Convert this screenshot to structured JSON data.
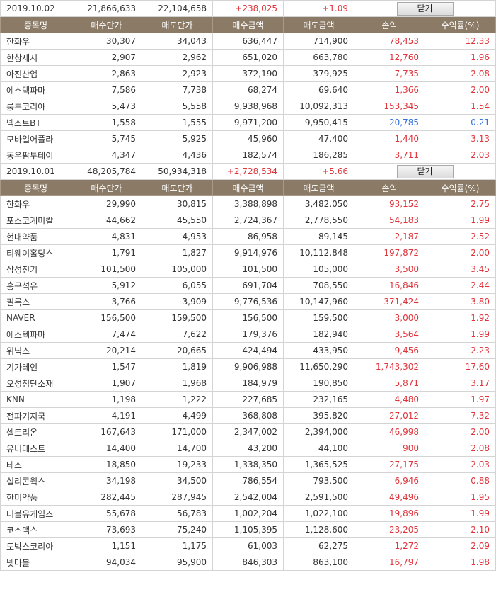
{
  "close_label": "닫기",
  "headers": [
    "종목명",
    "매수단가",
    "매도단가",
    "매수금액",
    "매도금액",
    "손익",
    "수익률(%)"
  ],
  "days": [
    {
      "date": "2019.10.02",
      "buy_total": "21,866,633",
      "sell_total": "22,104,658",
      "profit": "+238,025",
      "rate": "+1.09",
      "rows": [
        [
          "한화우",
          "30,307",
          "34,043",
          "636,447",
          "714,900",
          "78,453",
          "12.33"
        ],
        [
          "한창제지",
          "2,907",
          "2,962",
          "651,020",
          "663,780",
          "12,760",
          "1.96"
        ],
        [
          "아진산업",
          "2,863",
          "2,923",
          "372,190",
          "379,925",
          "7,735",
          "2.08"
        ],
        [
          "에스텍파마",
          "7,586",
          "7,738",
          "68,274",
          "69,640",
          "1,366",
          "2.00"
        ],
        [
          "룽투코리아",
          "5,473",
          "5,558",
          "9,938,968",
          "10,092,313",
          "153,345",
          "1.54"
        ],
        [
          "넥스트BT",
          "1,558",
          "1,555",
          "9,971,200",
          "9,950,415",
          "-20,785",
          "-0.21"
        ],
        [
          "모바일어플라",
          "5,745",
          "5,925",
          "45,960",
          "47,400",
          "1,440",
          "3.13"
        ],
        [
          "동우팜투테이",
          "4,347",
          "4,436",
          "182,574",
          "186,285",
          "3,711",
          "2.03"
        ]
      ]
    },
    {
      "date": "2019.10.01",
      "buy_total": "48,205,784",
      "sell_total": "50,934,318",
      "profit": "+2,728,534",
      "rate": "+5.66",
      "rows": [
        [
          "한화우",
          "29,990",
          "30,815",
          "3,388,898",
          "3,482,050",
          "93,152",
          "2.75"
        ],
        [
          "포스코케미칼",
          "44,662",
          "45,550",
          "2,724,367",
          "2,778,550",
          "54,183",
          "1.99"
        ],
        [
          "현대약품",
          "4,831",
          "4,953",
          "86,958",
          "89,145",
          "2,187",
          "2.52"
        ],
        [
          "티웨이홀딩스",
          "1,791",
          "1,827",
          "9,914,976",
          "10,112,848",
          "197,872",
          "2.00"
        ],
        [
          "삼성전기",
          "101,500",
          "105,000",
          "101,500",
          "105,000",
          "3,500",
          "3.45"
        ],
        [
          "흥구석유",
          "5,912",
          "6,055",
          "691,704",
          "708,550",
          "16,846",
          "2.44"
        ],
        [
          "필룩스",
          "3,766",
          "3,909",
          "9,776,536",
          "10,147,960",
          "371,424",
          "3.80"
        ],
        [
          "NAVER",
          "156,500",
          "159,500",
          "156,500",
          "159,500",
          "3,000",
          "1.92"
        ],
        [
          "에스텍파마",
          "7,474",
          "7,622",
          "179,376",
          "182,940",
          "3,564",
          "1.99"
        ],
        [
          "위닉스",
          "20,214",
          "20,665",
          "424,494",
          "433,950",
          "9,456",
          "2.23"
        ],
        [
          "기가레인",
          "1,547",
          "1,819",
          "9,906,988",
          "11,650,290",
          "1,743,302",
          "17.60"
        ],
        [
          "오성첨단소재",
          "1,907",
          "1,968",
          "184,979",
          "190,850",
          "5,871",
          "3.17"
        ],
        [
          "KNN",
          "1,198",
          "1,222",
          "227,685",
          "232,165",
          "4,480",
          "1.97"
        ],
        [
          "전파기지국",
          "4,191",
          "4,499",
          "368,808",
          "395,820",
          "27,012",
          "7.32"
        ],
        [
          "셀트리온",
          "167,643",
          "171,000",
          "2,347,002",
          "2,394,000",
          "46,998",
          "2.00"
        ],
        [
          "유니테스트",
          "14,400",
          "14,700",
          "43,200",
          "44,100",
          "900",
          "2.08"
        ],
        [
          "테스",
          "18,850",
          "19,233",
          "1,338,350",
          "1,365,525",
          "27,175",
          "2.03"
        ],
        [
          "실리콘웍스",
          "34,198",
          "34,500",
          "786,554",
          "793,500",
          "6,946",
          "0.88"
        ],
        [
          "한미약품",
          "282,445",
          "287,945",
          "2,542,004",
          "2,591,500",
          "49,496",
          "1.95"
        ],
        [
          "더블유게임즈",
          "55,678",
          "56,783",
          "1,002,204",
          "1,022,100",
          "19,896",
          "1.99"
        ],
        [
          "코스맥스",
          "73,693",
          "75,240",
          "1,105,395",
          "1,128,600",
          "23,205",
          "2.10"
        ],
        [
          "토박스코리아",
          "1,151",
          "1,175",
          "61,003",
          "62,275",
          "1,272",
          "2.09"
        ],
        [
          "넷마블",
          "94,034",
          "95,900",
          "846,303",
          "863,100",
          "16,797",
          "1.98"
        ]
      ]
    }
  ],
  "colors": {
    "header_bg": "#8a7a66",
    "positive": "#e0343b",
    "negative": "#2f6fe0"
  }
}
